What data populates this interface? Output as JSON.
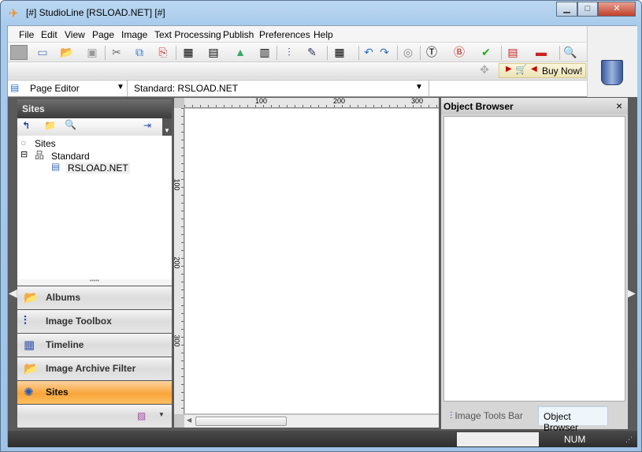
{
  "window": {
    "title": "[#] StudioLine [RSLOAD.NET] [#]",
    "min": "▁",
    "max": "□",
    "close": "✕"
  },
  "menu": [
    "File",
    "Edit",
    "View",
    "Page",
    "Image",
    "Text Processing",
    "Publish",
    "Preferences",
    "Help"
  ],
  "toolbar": {
    "buy_now": "Buy Now!"
  },
  "view_select": {
    "value": "Page Editor"
  },
  "page_select": {
    "value": "Standard: RSLOAD.NET"
  },
  "sites_panel": {
    "title": "Sites",
    "tree": {
      "root": "Sites",
      "group": "Standard",
      "page": "RSLOAD.NET"
    }
  },
  "nav": [
    {
      "label": "Albums",
      "icon": "folder-icon"
    },
    {
      "label": "Image Toolbox",
      "icon": "sliders-icon"
    },
    {
      "label": "Timeline",
      "icon": "calendar-icon"
    },
    {
      "label": "Image Archive Filter",
      "icon": "filter-folder-icon"
    },
    {
      "label": "Sites",
      "icon": "sites-icon",
      "active": true
    }
  ],
  "ruler": {
    "h": [
      "100",
      "200",
      "300"
    ],
    "v": [
      "100",
      "200",
      "300"
    ]
  },
  "object_browser": {
    "title": "Object Browser",
    "close": "×",
    "tabs": [
      "Image Tools Bar",
      "Object Browser"
    ],
    "active_tab": 1
  },
  "status": {
    "num": "NUM"
  },
  "colors": {
    "active_nav": "#f9a53a",
    "titlebar": "#a9cbec"
  }
}
